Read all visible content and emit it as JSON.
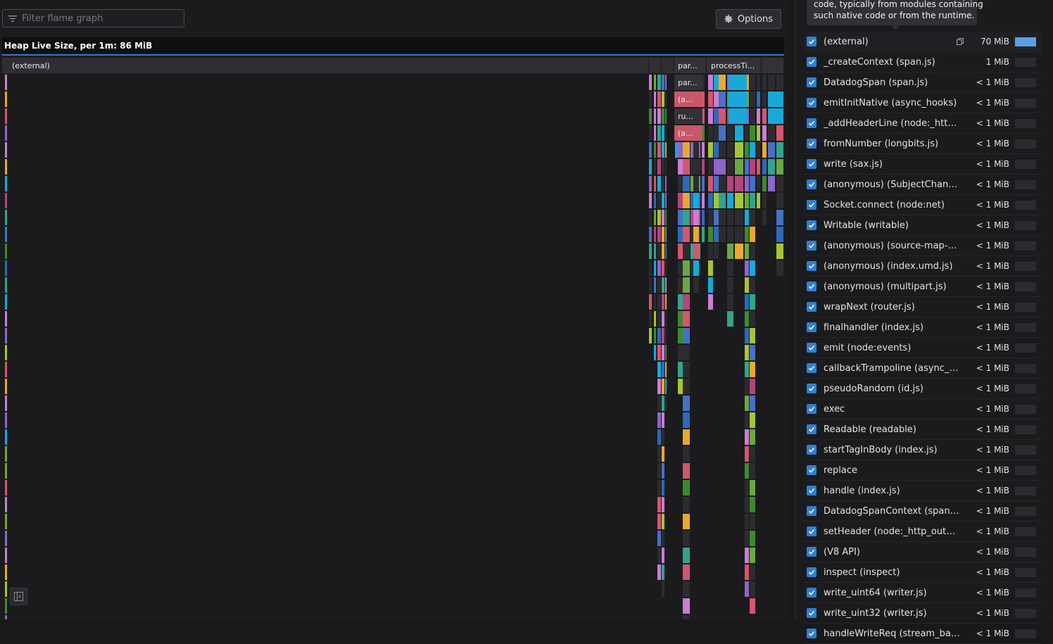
{
  "filter": {
    "placeholder": "Filter flame graph",
    "value": ""
  },
  "toolbar": {
    "options_label": "Options"
  },
  "graph": {
    "header": "Heap Live Size, per 1m: 86 MiB",
    "root_label": "(external)",
    "labels": [
      "par...",
      "processTi...",
      "par...",
      "(a...",
      "ru...",
      "(a..."
    ]
  },
  "tooltip": {
    "lines": [
      "code, typically from modules containing",
      "such native code or from the runtime."
    ]
  },
  "legend": [
    {
      "name": "(external)",
      "value": "70 MiB",
      "fraction": 1.0,
      "selected": true
    },
    {
      "name": "_createContext (span.js)",
      "value": "1 MiB",
      "fraction": 0.0
    },
    {
      "name": "DatadogSpan (span.js)",
      "value": "< 1 MiB",
      "fraction": 0.0
    },
    {
      "name": "emitInitNative (async_hooks)",
      "value": "< 1 MiB",
      "fraction": 0.0
    },
    {
      "name": "_addHeaderLine (node:_http_in...",
      "value": "< 1 MiB",
      "fraction": 0.0
    },
    {
      "name": "fromNumber (longbits.js)",
      "value": "< 1 MiB",
      "fraction": 0.0
    },
    {
      "name": "write (sax.js)",
      "value": "< 1 MiB",
      "fraction": 0.0
    },
    {
      "name": "(anonymous) (SubjectChanged...",
      "value": "< 1 MiB",
      "fraction": 0.0
    },
    {
      "name": "Socket.connect (node:net)",
      "value": "< 1 MiB",
      "fraction": 0.0
    },
    {
      "name": "Writable (writable)",
      "value": "< 1 MiB",
      "fraction": 0.0
    },
    {
      "name": "(anonymous) (source-map-con...",
      "value": "< 1 MiB",
      "fraction": 0.0
    },
    {
      "name": "(anonymous) (index.umd.js)",
      "value": "< 1 MiB",
      "fraction": 0.0
    },
    {
      "name": "(anonymous) (multipart.js)",
      "value": "< 1 MiB",
      "fraction": 0.0
    },
    {
      "name": "wrapNext (router.js)",
      "value": "< 1 MiB",
      "fraction": 0.0
    },
    {
      "name": "finalhandler (index.js)",
      "value": "< 1 MiB",
      "fraction": 0.0
    },
    {
      "name": "emit (node:events)",
      "value": "< 1 MiB",
      "fraction": 0.0
    },
    {
      "name": "callbackTrampoline (async_hoo...",
      "value": "< 1 MiB",
      "fraction": 0.0
    },
    {
      "name": "pseudoRandom (id.js)",
      "value": "< 1 MiB",
      "fraction": 0.0
    },
    {
      "name": "exec",
      "value": "< 1 MiB",
      "fraction": 0.0
    },
    {
      "name": "Readable (readable)",
      "value": "< 1 MiB",
      "fraction": 0.0
    },
    {
      "name": "startTagInBody (index.js)",
      "value": "< 1 MiB",
      "fraction": 0.0
    },
    {
      "name": "replace",
      "value": "< 1 MiB",
      "fraction": 0.0
    },
    {
      "name": "handle (index.js)",
      "value": "< 1 MiB",
      "fraction": 0.0
    },
    {
      "name": "DatadogSpanContext (span_co...",
      "value": "< 1 MiB",
      "fraction": 0.0
    },
    {
      "name": "setHeader (node:_http_outgoin...",
      "value": "< 1 MiB",
      "fraction": 0.0
    },
    {
      "name": "(V8 API)",
      "value": "< 1 MiB",
      "fraction": 0.0
    },
    {
      "name": "inspect (inspect)",
      "value": "< 1 MiB",
      "fraction": 0.0
    },
    {
      "name": "write_uint64 (writer.js)",
      "value": "< 1 MiB",
      "fraction": 0.0
    },
    {
      "name": "write_uint32 (writer.js)",
      "value": "< 1 MiB",
      "fraction": 0.0
    },
    {
      "name": "handleWriteReq (stream_base_...",
      "value": "< 1 MiB",
      "fraction": 0.0
    }
  ],
  "colors": {
    "checkbox": "#2f7fd4",
    "accent_line": "#3a78c2",
    "legend_bar": "#5aa0e0",
    "frame_palette": [
      "#19a9d8",
      "#d4566f",
      "#8e65c9",
      "#3d8a2e",
      "#4671c7",
      "#c87fd4",
      "#e8a92e",
      "#31a58c",
      "#a7c437",
      "#2e6ab8",
      "#b3457f",
      "#6aa842"
    ]
  }
}
